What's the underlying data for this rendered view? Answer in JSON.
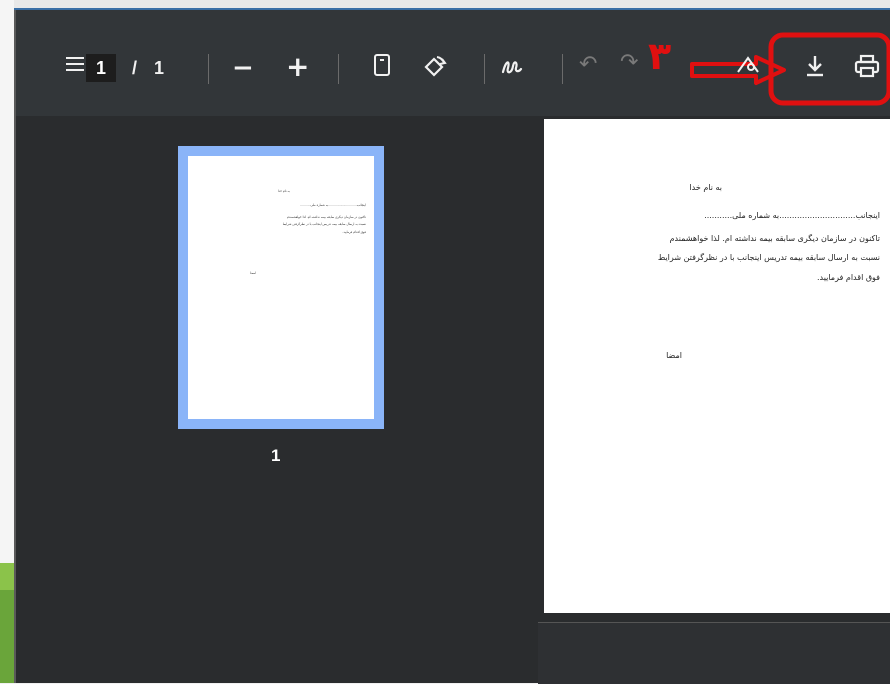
{
  "toolbar": {
    "current_page": "1",
    "separator": "/",
    "total_pages": "1",
    "zoom_out": "−",
    "zoom_in": "+",
    "undo": "↶",
    "redo": "↷",
    "annotation_number": "۳"
  },
  "thumbnail": {
    "label": "1"
  },
  "document": {
    "title": "به نام خدا",
    "line1": "اینجانب..............................به شماره ملی...........",
    "para1": "تاکنون در سازمان دیگری سابقه بیمه نداشته ام. لذا خواهشمندم",
    "para2": "نسبت به ارسال سابقه بیمه تدریس اینجانب با در نظرگرفتن شرایط",
    "para3": "فوق اقدام فرمایید.",
    "signature": "امضا"
  },
  "colors": {
    "toolbar_bg": "#323639",
    "thumb_border": "#8ab4f8",
    "annotation_red": "#e01010"
  }
}
